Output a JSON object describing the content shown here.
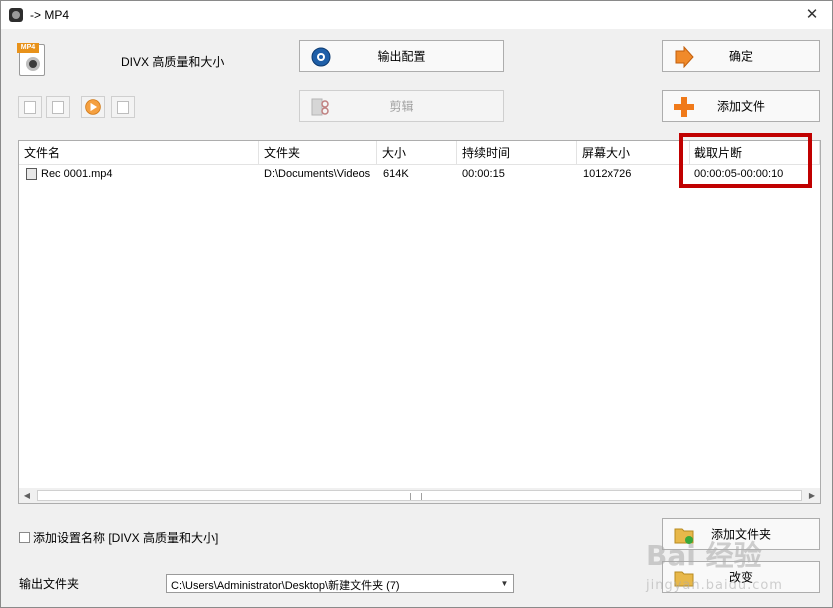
{
  "window": {
    "title": "-> MP4",
    "close_glyph": "✕",
    "app_icon": "format-factory-icon"
  },
  "preset": {
    "icon": "mp4-file-icon",
    "icon_badge": "MP4",
    "label": "DIVX 高质量和大小"
  },
  "toolbar": {
    "output_config_label": "输出配置",
    "clip_label": "剪辑",
    "ok_label": "确定",
    "add_file_label": "添加文件",
    "add_folder_label": "添加文件夹",
    "change_label": "改变"
  },
  "file_list": {
    "columns": [
      "文件名",
      "文件夹",
      "大小",
      "持续时间",
      "屏幕大小",
      "截取片断"
    ],
    "rows": [
      {
        "name": "Rec 0001.mp4",
        "folder": "D:\\Documents\\Videos",
        "size": "614K",
        "duration": "00:00:15",
        "screen_size": "1012x726",
        "clip_range": "00:00:05-00:00:10"
      }
    ]
  },
  "options": {
    "add_setting_name_label": "添加设置名称 [DIVX 高质量和大小]",
    "add_setting_name_checked": false,
    "output_folder_label": "输出文件夹",
    "output_folder_value": "C:\\Users\\Administrator\\Desktop\\新建文件夹 (7)"
  },
  "annotation": {
    "highlight_color": "#c00000"
  },
  "watermark": {
    "main": "Bai 经验",
    "sub": "jingyan.baidu.com"
  }
}
